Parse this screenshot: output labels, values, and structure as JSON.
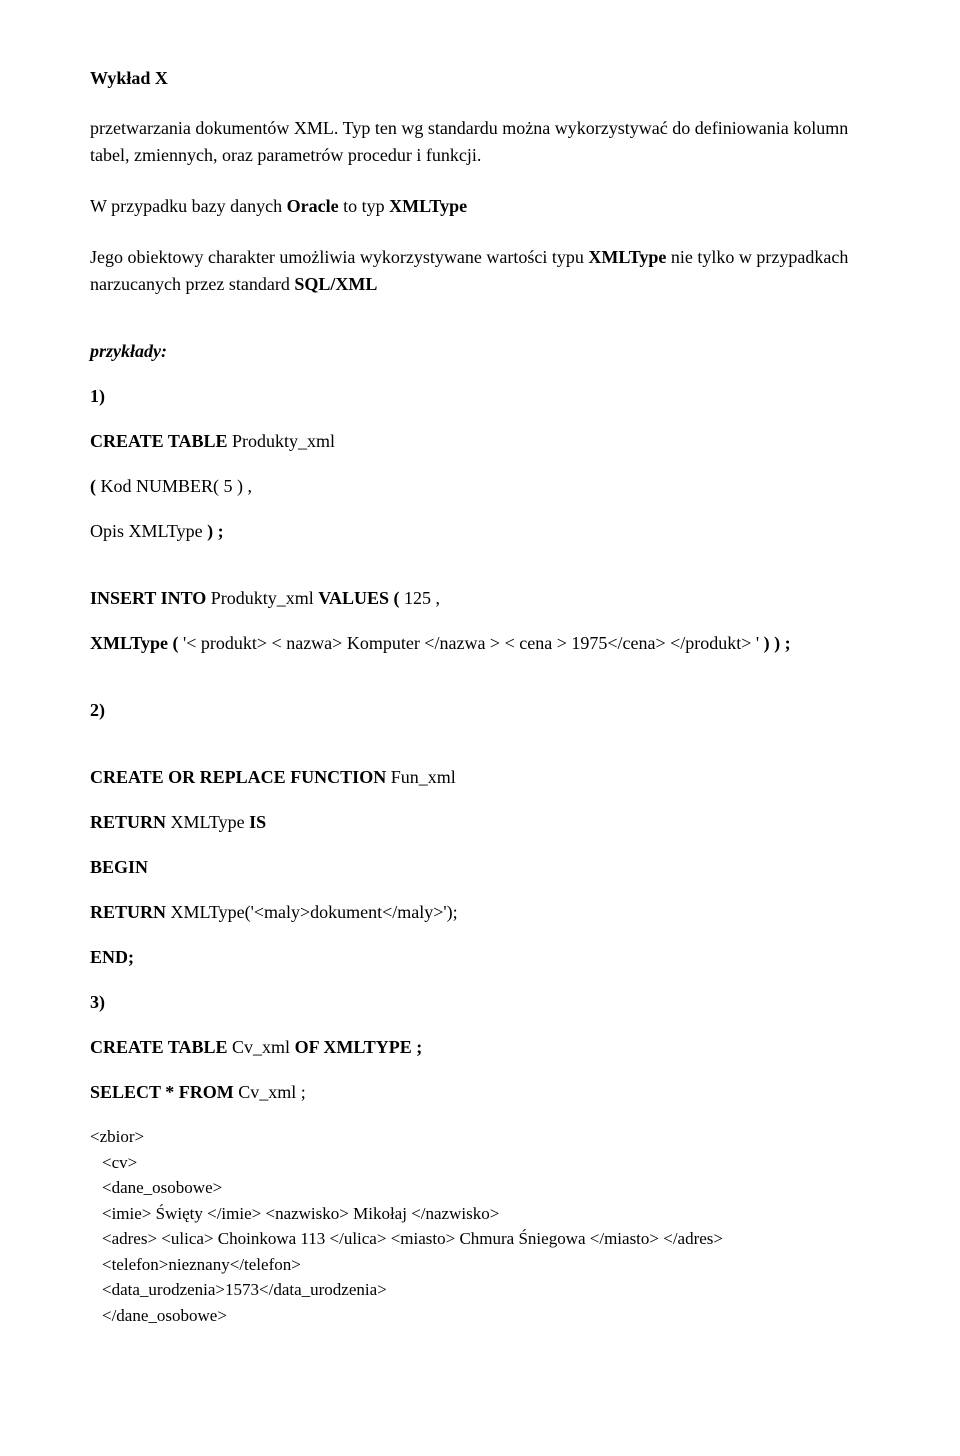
{
  "header": "Wykład X",
  "p1": "przetwarzania dokumentów XML. Typ ten wg standardu można wykorzystywać do definiowania kolumn tabel, zmiennych, oraz parametrów procedur i funkcji.",
  "p2a": "W przypadku bazy danych ",
  "p2b": " to typ ",
  "p2_oracle": "Oracle",
  "p2_xmltype": "XMLType",
  "p3a": "Jego obiektowy charakter umożliwia wykorzystywane wartości typu ",
  "p3_xmltype": "XMLType",
  "p3b": " nie tylko w przypadkach narzucanych przez standard ",
  "p3_sqlxml": "SQL/XML",
  "przyklady": "przykłady:",
  "num1": "1)",
  "ct": "CREATE  TABLE",
  "ct_prod": "  Produkty_xml",
  "paren_open": "( ",
  "kod": "Kod  NUMBER( 5 ) ,",
  "opis_pre": " Opis  XMLType",
  "opis_close": " ) ;",
  "insert_kw": "INSERT  INTO",
  "insert_mid": "  Produkty_xml  ",
  "values_kw": "VALUES ( ",
  "insert_val": "125 ,",
  "xmltype_kw": "XMLType (",
  "xmltype_arg": " '< produkt> < nazwa> Komputer </nazwa > < cena > 1975</cena> </produkt> ' ",
  "xmltype_close": ") ) ;",
  "num2": "2)",
  "corf": "CREATE OR  REPLACE FUNCTION",
  "corf_name": " Fun_xml",
  "ret_kw": "RETURN ",
  "ret_type": "XMLType",
  "is_kw": " IS",
  "begin": "BEGIN",
  "ret2": "RETURN ",
  "ret2_body": "XMLType('<maly>dokument</maly>');",
  "end": "END;",
  "num3": "3)",
  "ct2": "CREATE  TABLE",
  "ct2_name": "  Cv_xml  ",
  "of_kw": "OF   XMLTYPE ;",
  "select_kw": "SELECT  *  FROM",
  "select_rest": "  Cv_xml  ;",
  "x_zbior": "<zbior>",
  "x_cv": " <cv>",
  "x_do": "  <dane_osobowe>",
  "x_imie": "   <imie> Święty </imie> <nazwisko> Mikołaj </nazwisko>",
  "x_adres": "   <adres> <ulica> Choinkowa 113 </ulica> <miasto> Chmura Śniegowa </miasto> </adres>",
  "x_tel": "   <telefon>nieznany</telefon>",
  "x_data": "   <data_urodzenia>1573</data_urodzenia>",
  "x_do_close": "  </dane_osobowe>"
}
